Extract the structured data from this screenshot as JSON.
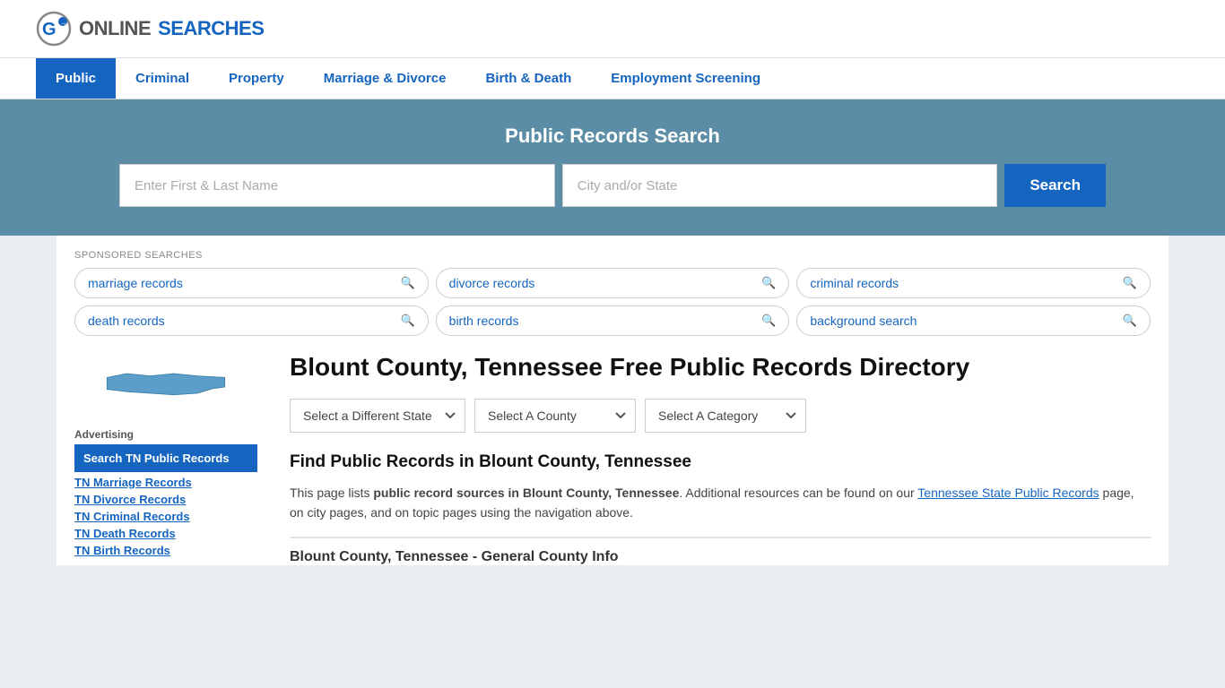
{
  "logo": {
    "text_online": "ONLINE",
    "text_searches": "SEARCHES"
  },
  "nav": {
    "items": [
      {
        "label": "Public",
        "active": true
      },
      {
        "label": "Criminal",
        "active": false
      },
      {
        "label": "Property",
        "active": false
      },
      {
        "label": "Marriage & Divorce",
        "active": false
      },
      {
        "label": "Birth & Death",
        "active": false
      },
      {
        "label": "Employment Screening",
        "active": false
      }
    ]
  },
  "search_banner": {
    "title": "Public Records Search",
    "name_placeholder": "Enter First & Last Name",
    "location_placeholder": "City and/or State",
    "button_label": "Search"
  },
  "sponsored": {
    "label": "SPONSORED SEARCHES",
    "tags": [
      {
        "label": "marriage records"
      },
      {
        "label": "divorce records"
      },
      {
        "label": "criminal records"
      },
      {
        "label": "death records"
      },
      {
        "label": "birth records"
      },
      {
        "label": "background search"
      }
    ]
  },
  "page": {
    "title": "Blount County, Tennessee Free Public Records Directory",
    "dropdowns": {
      "state_label": "Select a Different State",
      "county_label": "Select A County",
      "category_label": "Select A Category"
    },
    "find_title": "Find Public Records in Blount County, Tennessee",
    "description": "This page lists ",
    "description_bold": "public record sources in Blount County, Tennessee",
    "description_mid": ". Additional resources can be found on our ",
    "description_link": "Tennessee State Public Records",
    "description_end": " page, on city pages, and on topic pages using the navigation above.",
    "section_subtitle": "Blount County, Tennessee - General County Info"
  },
  "sidebar": {
    "advertising_label": "Advertising",
    "ad_highlight": "Search TN Public Records",
    "links": [
      "TN Marriage Records",
      "TN Divorce Records",
      "TN Criminal Records",
      "TN Death Records",
      "TN Birth Records"
    ]
  }
}
